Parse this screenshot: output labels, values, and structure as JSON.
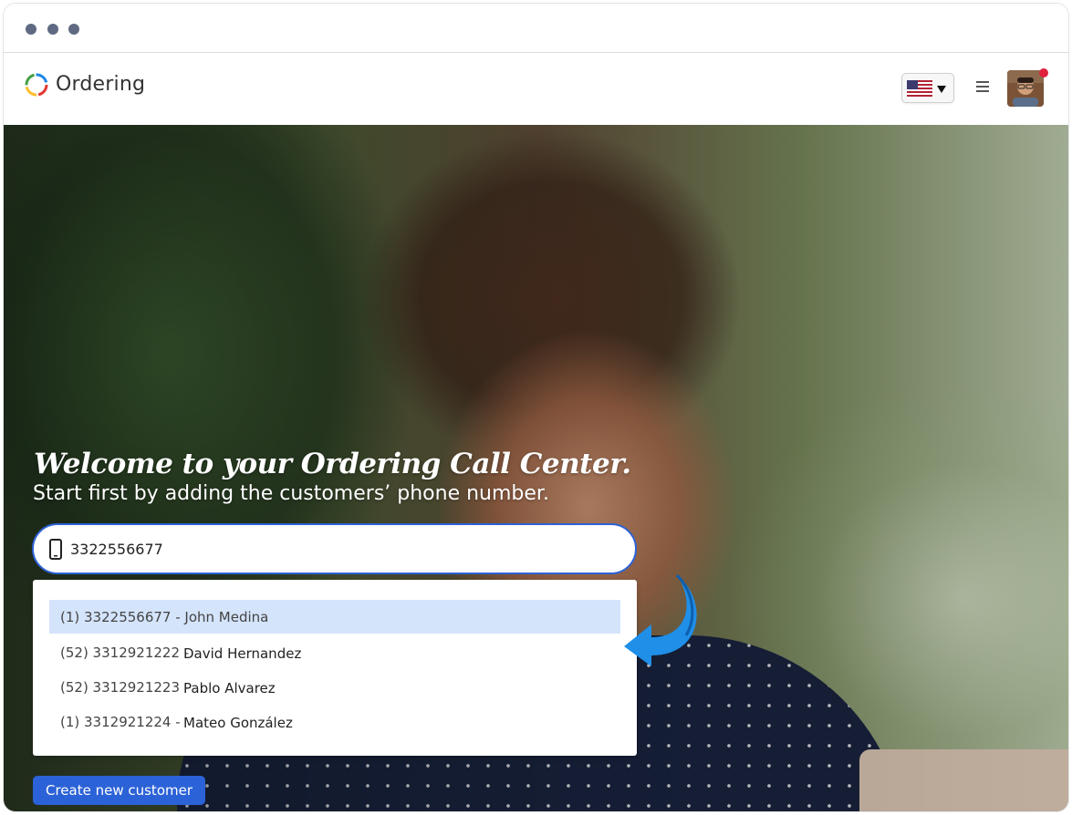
{
  "app": {
    "brand": "Ordering"
  },
  "header": {
    "language_flag": "us-flag-icon",
    "notification_color": "#e0203d"
  },
  "hero": {
    "title": "Welcome to your Ordering Call Center.",
    "subtitle": "Start first by adding the customers’ phone number."
  },
  "search": {
    "value": "3322556677",
    "icon": "mobile-phone-icon"
  },
  "suggestions": [
    {
      "number": "(1)  3322556677 - John Medina",
      "name": ""
    },
    {
      "number": "(52) 3312921222 -",
      "name": "David Hernandez"
    },
    {
      "number": "(52) 3312921223 -",
      "name": "Pablo Alvarez"
    },
    {
      "number": "(1) 3312921224 -",
      "name": "Mateo González"
    }
  ],
  "actions": {
    "create_customer": "Create new customer"
  },
  "colors": {
    "accent": "#2c62d7",
    "highlight": "#d4e4fb",
    "arrow": "#1f8fe8"
  }
}
